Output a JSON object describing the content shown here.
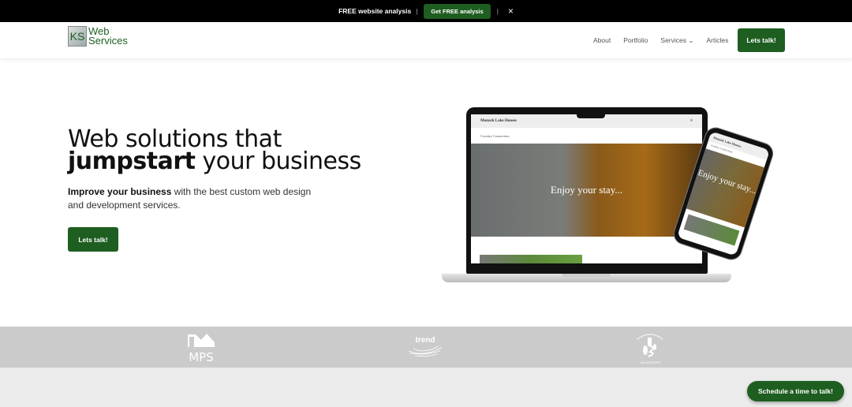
{
  "topbar": {
    "text": "FREE website analysis",
    "separator": "|",
    "button_label": "Get FREE analysis",
    "close_icon": "×"
  },
  "header": {
    "logo": {
      "monogram": "KS",
      "line1": "Web",
      "line2": "Services"
    },
    "nav": [
      {
        "label": "About"
      },
      {
        "label": "Portfolio"
      },
      {
        "label": "Services",
        "chevron": "⌄"
      },
      {
        "label": "Articles"
      }
    ],
    "cta_label": "Lets talk!"
  },
  "hero": {
    "title_pre": "Web solutions that ",
    "title_bold": "jumpstart",
    "title_post": " your business",
    "subtitle_bold": "Improve your business",
    "subtitle_rest": " with the best custom web design and development services.",
    "button_label": "Lets talk!"
  },
  "mockup": {
    "site_title": "Monark Lake Houses",
    "menu_icon": "≡",
    "site_subtitle": "Country Connection",
    "hero_text": "Enjoy your stay..."
  },
  "logos": [
    {
      "name": "MPS",
      "text": "MPS"
    },
    {
      "name": "trend",
      "text": "trend"
    },
    {
      "name": "volunteers",
      "text": "VOLUNTEERS"
    }
  ],
  "colors": {
    "brand_green": "#1e5e20"
  },
  "floating_button": {
    "label": "Schedule a time to talk!"
  }
}
